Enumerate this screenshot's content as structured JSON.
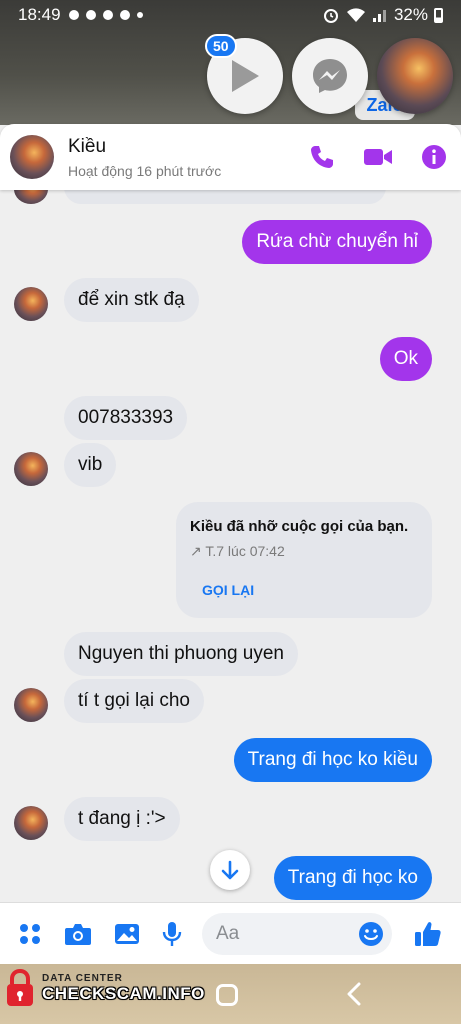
{
  "status_bar": {
    "time": "18:49",
    "battery": "32%"
  },
  "bubble_heads": {
    "badge_count": "50",
    "zalo_label": "Zalo"
  },
  "header": {
    "name": "Kiều",
    "status": "Hoạt động 16 phút trước"
  },
  "messages": {
    "m1": "Rứa chừ chuyển hỉ",
    "m2": "để xin stk đạ",
    "m3": "Ok",
    "m4": "007833393",
    "m5": "vib",
    "m6": "Nguyen thi phuong uyen",
    "m7": "tí t gọi lại cho",
    "m8": "Trang đi học ko kiều",
    "m9": "t đang ị :'>",
    "m10": "Trang đi học ko"
  },
  "missed_call": {
    "title": "Kiều đã nhỡ cuộc gọi của bạn.",
    "time": "↗ T.7 lúc 07:42",
    "action": "GỌI LẠI"
  },
  "composer": {
    "placeholder": "Aa"
  },
  "watermark": {
    "small": "DATA CENTER",
    "big": "CHECKSCAM.INFO"
  },
  "colors": {
    "accent_purple": "#a335eb",
    "messenger_blue": "#1877f2",
    "header_icons": "#a335eb"
  },
  "icons": [
    "play-icon",
    "messenger-icon",
    "phone-icon",
    "video-icon",
    "info-icon",
    "apps-icon",
    "camera-icon",
    "image-icon",
    "mic-icon",
    "emoji-icon",
    "like-icon",
    "arrow-down-icon"
  ]
}
